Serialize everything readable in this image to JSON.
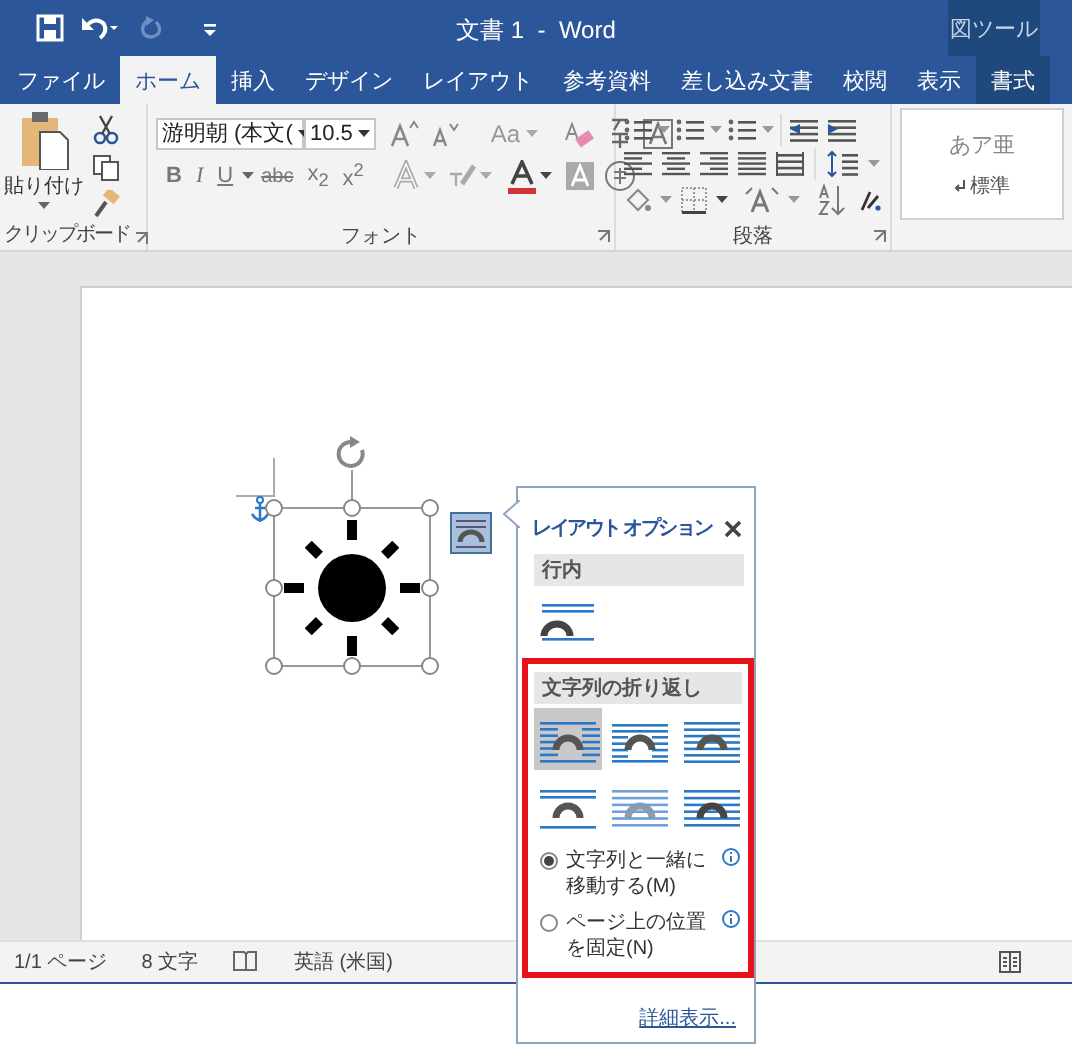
{
  "title_bar": {
    "title": "文書 1  -  Word",
    "context_group": "図ツール"
  },
  "tabs": [
    {
      "label": "ファイル",
      "selected": false,
      "kind": "normal"
    },
    {
      "label": "ホーム",
      "selected": true,
      "kind": "normal"
    },
    {
      "label": "挿入",
      "selected": false,
      "kind": "normal"
    },
    {
      "label": "デザイン",
      "selected": false,
      "kind": "normal"
    },
    {
      "label": "レイアウト",
      "selected": false,
      "kind": "normal"
    },
    {
      "label": "参考資料",
      "selected": false,
      "kind": "normal"
    },
    {
      "label": "差し込み文書",
      "selected": false,
      "kind": "normal"
    },
    {
      "label": "校閲",
      "selected": false,
      "kind": "normal"
    },
    {
      "label": "表示",
      "selected": false,
      "kind": "normal"
    },
    {
      "label": "書式",
      "selected": false,
      "kind": "contextual"
    }
  ],
  "ribbon": {
    "clipboard": {
      "paste_label": "貼り付け",
      "group_label": "クリップボード"
    },
    "font": {
      "font_name": "游明朝 (本文(",
      "font_size": "10.5",
      "case_button": "Aa",
      "format_buttons": [
        "B",
        "I",
        "U",
        "abc",
        "x$_{2}$",
        "x$^{2}$"
      ],
      "group_label": "フォント"
    },
    "paragraph": {
      "group_label": "段落"
    },
    "styles": {
      "sample": "あア亜",
      "style_name": "標準"
    }
  },
  "layout_options": {
    "title": "レイアウト オプション",
    "sections": [
      {
        "heading": "行内",
        "options": [
          {
            "kind": "in-line",
            "selected": false
          }
        ]
      },
      {
        "heading": "文字列の折り返し",
        "options": [
          {
            "kind": "square",
            "selected": true
          },
          {
            "kind": "tight",
            "selected": false
          },
          {
            "kind": "through",
            "selected": false
          },
          {
            "kind": "top-bottom",
            "selected": false
          },
          {
            "kind": "behind",
            "selected": false
          },
          {
            "kind": "in-front",
            "selected": false
          }
        ]
      }
    ],
    "move_options": [
      {
        "label": "文字列と一緒に移動する(M)",
        "selected": true
      },
      {
        "label": "ページ上の位置を固定(N)",
        "selected": false
      }
    ],
    "link": "詳細表示..."
  },
  "status_bar": {
    "items": [
      "1/1 ページ",
      "8 文字",
      "英語 (米国)"
    ]
  }
}
